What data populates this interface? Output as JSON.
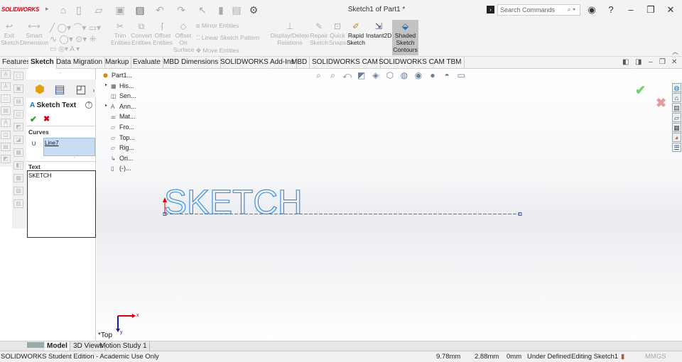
{
  "app": {
    "logo_text": "SOLIDWORKS",
    "document_title": "Sketch1 of Part1 *"
  },
  "search": {
    "placeholder": "Search Commands"
  },
  "command_manager": {
    "exit_sketch": "Exit Sketch",
    "smart_dimension": "Smart Dimension",
    "trim_entities": "Trim Entities",
    "convert_entities": "Convert Entities",
    "offset_entities": "Offset Entities",
    "offset_on_surface": "Offset On Surface",
    "mirror_entities": "Mirror Entities",
    "linear_sketch_pattern": "Linear Sketch Pattern",
    "move_entities": "Move Entities",
    "display_delete_relations": "Display/Delete Relations",
    "repair_sketch": "Repair Sketch",
    "quick_snaps": "Quick Snaps",
    "rapid_sketch": "Rapid Sketch",
    "instant2d": "Instant2D",
    "shaded_sketch_contours": "Shaded Sketch Contours"
  },
  "tabs": [
    "Features",
    "Sketch",
    "Data Migration",
    "Markup",
    "Evaluate",
    "MBD Dimensions",
    "SOLIDWORKS Add-Ins",
    "MBD",
    "SOLIDWORKS CAM",
    "SOLIDWORKS CAM TBM"
  ],
  "active_tab": "Sketch",
  "property_manager": {
    "title": "Sketch Text",
    "curves_label": "Curves",
    "curves_value": "Line7",
    "text_label": "Text",
    "text_value": "SKETCH"
  },
  "tree": {
    "root": "Part1...",
    "items": [
      {
        "label": "His...",
        "expandable": true
      },
      {
        "label": "Sen...",
        "expandable": false
      },
      {
        "label": "Ann...",
        "expandable": true
      },
      {
        "label": "Mat...",
        "expandable": false
      },
      {
        "label": "Fro...",
        "expandable": false
      },
      {
        "label": "Top...",
        "expandable": false
      },
      {
        "label": "Rig...",
        "expandable": false
      },
      {
        "label": "Ori...",
        "expandable": false
      },
      {
        "label": "(-)...",
        "expandable": false
      }
    ]
  },
  "sketch": {
    "text": "SKETCH",
    "view_name": "*Top",
    "triad_x": "x",
    "triad_y": "y"
  },
  "bottom_tabs": [
    "Model",
    "3D Views",
    "Motion Study 1"
  ],
  "active_bottom_tab": "Model",
  "status": {
    "edition": "SOLIDWORKS Student Edition - Academic Use Only",
    "x": "9.78mm",
    "y": "2.88mm",
    "z": "0mm",
    "state": "Under Defined",
    "editing": "Editing Sketch1",
    "units": "MMGS"
  },
  "colors": {
    "sketch_blue": "#1f86e0",
    "shaded_bg": "#c2c2c2",
    "logo_red": "#d0021b"
  }
}
